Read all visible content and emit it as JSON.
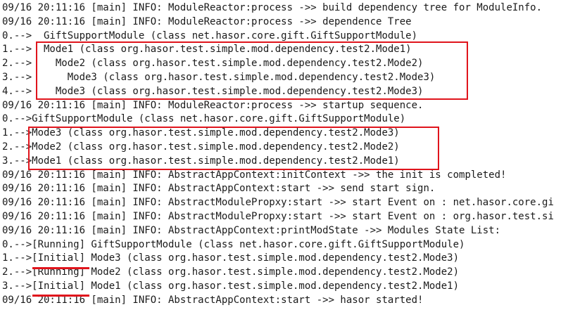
{
  "console": {
    "lines": [
      "09/16 20:11:16 [main] INFO: ModuleReactor:process ->> build dependency tree for ModuleInfo.",
      "09/16 20:11:16 [main] INFO: ModuleReactor:process ->> dependence Tree",
      "0.-->  GiftSupportModule (class net.hasor.core.gift.GiftSupportModule)",
      "1.-->  Mode1 (class org.hasor.test.simple.mod.dependency.test2.Mode1)",
      "2.-->    Mode2 (class org.hasor.test.simple.mod.dependency.test2.Mode2)",
      "3.-->      Mode3 (class org.hasor.test.simple.mod.dependency.test2.Mode3)",
      "4.-->    Mode3 (class org.hasor.test.simple.mod.dependency.test2.Mode3)",
      "09/16 20:11:16 [main] INFO: ModuleReactor:process ->> startup sequence.",
      "0.-->GiftSupportModule (class net.hasor.core.gift.GiftSupportModule)",
      "1.-->Mode3 (class org.hasor.test.simple.mod.dependency.test2.Mode3)",
      "2.-->Mode2 (class org.hasor.test.simple.mod.dependency.test2.Mode2)",
      "3.-->Mode1 (class org.hasor.test.simple.mod.dependency.test2.Mode1)",
      "09/16 20:11:16 [main] INFO: AbstractAppContext:initContext ->> the init is completed!",
      "09/16 20:11:16 [main] INFO: AbstractAppContext:start ->> send start sign.",
      "09/16 20:11:16 [main] INFO: AbstractModulePropxy:start ->> start Event on : net.hasor.core.gi",
      "09/16 20:11:16 [main] INFO: AbstractModulePropxy:start ->> start Event on : org.hasor.test.si",
      "09/16 20:11:16 [main] INFO: AbstractAppContext:printModState ->> Modules State List:",
      "0.-->[Running] GiftSupportModule (class net.hasor.core.gift.GiftSupportModule)",
      "1.-->[Initial] Mode3 (class org.hasor.test.simple.mod.dependency.test2.Mode3)",
      "2.-->[Running] Mode2 (class org.hasor.test.simple.mod.dependency.test2.Mode2)",
      "3.-->[Initial] Mode1 (class org.hasor.test.simple.mod.dependency.test2.Mode1)",
      "09/16 20:11:16 [main] INFO: AbstractAppContext:start ->> hasor started!"
    ]
  },
  "highlight_color": "#e0141c"
}
